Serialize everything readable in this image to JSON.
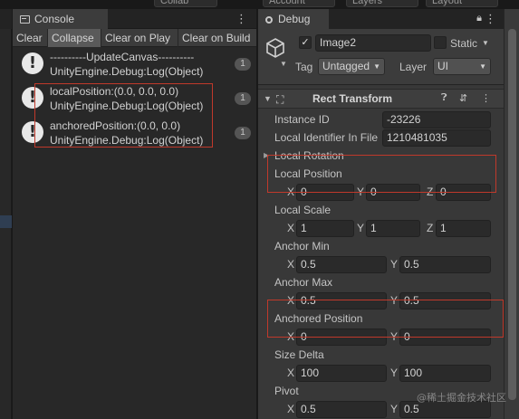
{
  "toolbar": {
    "buttons": [
      "Collab",
      "Account",
      "Layers",
      "Layout"
    ]
  },
  "console": {
    "tab_label": "Console",
    "buttons": [
      "Clear",
      "Collapse",
      "Clear on Play",
      "Clear on Build"
    ],
    "entries": [
      {
        "line1": "----------UpdateCanvas----------",
        "line2": "UnityEngine.Debug:Log(Object)",
        "count": "1"
      },
      {
        "line1": "localPosition:(0.0, 0.0, 0.0)",
        "line2": "UnityEngine.Debug:Log(Object)",
        "count": "1"
      },
      {
        "line1": "anchoredPosition:(0.0, 0.0)",
        "line2": "UnityEngine.Debug:Log(Object)",
        "count": "1"
      }
    ]
  },
  "inspector": {
    "tab_label": "Debug",
    "object_name": "Image2",
    "static_label": "Static",
    "tag_label": "Tag",
    "tag_value": "Untagged",
    "layer_label": "Layer",
    "layer_value": "UI",
    "component_title": "Rect Transform",
    "instance_id_label": "Instance ID",
    "instance_id_value": "-23226",
    "local_identifier_label": "Local Identifier In File",
    "local_identifier_value": "1210481035",
    "local_rotation_label": "Local Rotation",
    "local_position": {
      "label": "Local Position",
      "x": "0",
      "y": "0",
      "z": "0"
    },
    "local_scale": {
      "label": "Local Scale",
      "x": "1",
      "y": "1",
      "z": "1"
    },
    "anchor_min": {
      "label": "Anchor Min",
      "x": "0.5",
      "y": "0.5"
    },
    "anchor_max": {
      "label": "Anchor Max",
      "x": "0.5",
      "y": "0.5"
    },
    "anchored_position": {
      "label": "Anchored Position",
      "x": "0",
      "y": "0"
    },
    "size_delta": {
      "label": "Size Delta",
      "x": "100",
      "y": "100"
    },
    "pivot": {
      "label": "Pivot",
      "x": "0.5",
      "y": "0.5"
    },
    "axis": {
      "x": "X",
      "y": "Y",
      "z": "Z"
    }
  },
  "watermark": "@稀土掘金技术社区",
  "colors": {
    "panel_bg": "#383838",
    "console_bg": "#282828",
    "highlight_border": "#c0392b",
    "field_bg": "#2a2a2a"
  }
}
